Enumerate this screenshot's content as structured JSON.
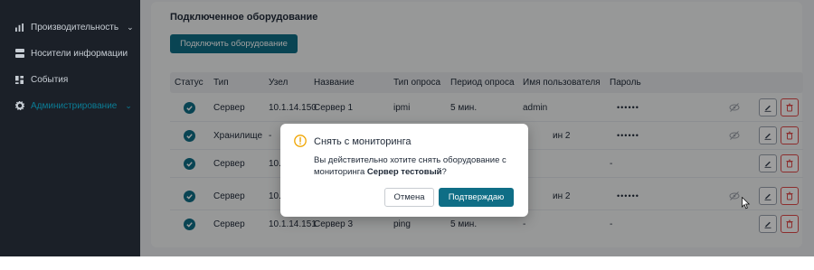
{
  "sidebar": {
    "items": [
      {
        "label": "Производительность",
        "icon": "bar-chart-icon",
        "has_chevron": true
      },
      {
        "label": "Носители информации",
        "icon": "storage-icon"
      },
      {
        "label": "События",
        "icon": "grid-icon"
      },
      {
        "label": "Администрирование",
        "icon": "gear-icon",
        "has_chevron": true,
        "active": true
      }
    ]
  },
  "main": {
    "section_title": "Подключенное оборудование",
    "connect_button": "Подключить оборудование",
    "columns": [
      "Статус",
      "Тип",
      "Узел",
      "Название",
      "Тип опроса",
      "Период опроса",
      "Имя пользователя",
      "Пароль"
    ],
    "rows": [
      {
        "type": "Сервер",
        "node": "10.1.14.150",
        "name": "Сервер 1",
        "poll_type": "ipmi",
        "period": "5 мин.",
        "user": "admin",
        "password": "••••••",
        "has_eye": true
      },
      {
        "type": "Хранилище",
        "node": "-",
        "name": "",
        "poll_type": "",
        "period": "",
        "user": "ин 2",
        "password": "••••••",
        "has_eye": true
      },
      {
        "type": "Сервер",
        "node": "10.1.14",
        "name": "",
        "poll_type": "",
        "period": "",
        "user": "",
        "password": "-",
        "has_eye": false
      },
      {
        "type": "Сервер",
        "node": "10.1.14",
        "name": "",
        "poll_type": "",
        "period": "",
        "user": "ин 2",
        "password": "••••••",
        "has_eye": true
      },
      {
        "type": "Сервер",
        "node": "10.1.14.151",
        "name": "Сервер 3",
        "poll_type": "ping",
        "period": "5 мин.",
        "user": "-",
        "password": "-",
        "has_eye": false
      }
    ]
  },
  "modal": {
    "title": "Снять с мониторинга",
    "body_prefix": "Вы действительно хотите снять оборудование с мониторинга ",
    "body_bold": "Сервер тестовый",
    "body_suffix": "?",
    "cancel_label": "Отмена",
    "confirm_label": "Подтверждаю"
  },
  "colors": {
    "accent": "#0f6e86",
    "danger": "#e24a4a",
    "warning": "#f0a500",
    "sidebar_bg": "#1b2028"
  }
}
